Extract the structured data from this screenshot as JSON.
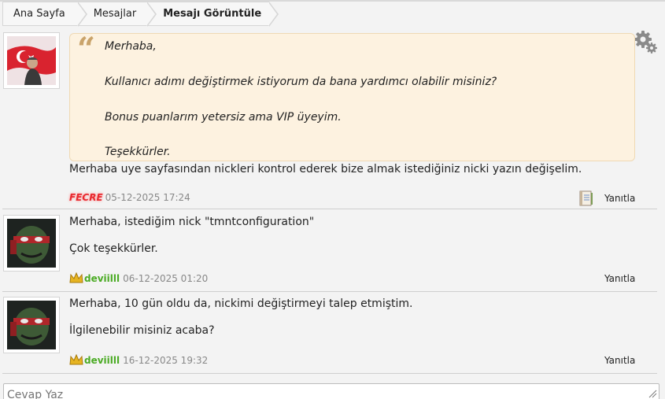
{
  "breadcrumb": {
    "items": [
      {
        "label": "Ana Sayfa"
      },
      {
        "label": "Mesajlar"
      },
      {
        "label": "Mesajı Görüntüle"
      }
    ]
  },
  "messages": [
    {
      "quote": {
        "lines": [
          "Merhaba,",
          "",
          "Kullanıcı adımı değiştirmek istiyorum da bana yardımcı olabilir misiniz?",
          "",
          "Bonus puanlarım yetersiz ama VIP üyeyim.",
          "",
          "Teşekkürler."
        ]
      },
      "body": [
        "Merhaba uye sayfasından nickleri kontrol ederek bize almak istediğiniz nicki yazın değişelim."
      ],
      "user": "FECRE",
      "date": "05-12-2025 17:24",
      "reply_label": "Yanıtla"
    },
    {
      "body": [
        "Merhaba, istediğim nick \"tmntconfiguration\"",
        "Çok teşekkürler."
      ],
      "user": "deviilll",
      "date": "06-12-2025 01:20",
      "reply_label": "Yanıtla"
    },
    {
      "body": [
        "Merhaba, 10 gün oldu da, nickimi değiştirmeyi talep etmiştim.",
        "İlgilenebilir misiniz acaba?"
      ],
      "user": "deviilll",
      "date": "16-12-2025 19:32",
      "reply_label": "Yanıtla"
    }
  ],
  "reply_box": {
    "placeholder": "Cevap Yaz"
  },
  "colors": {
    "admin_user": "#e8292f",
    "vip_user": "#4bab24",
    "quote_bg": "#fdf2e0"
  },
  "icons": [
    "gear-icon",
    "book-icon",
    "crown-icon"
  ]
}
